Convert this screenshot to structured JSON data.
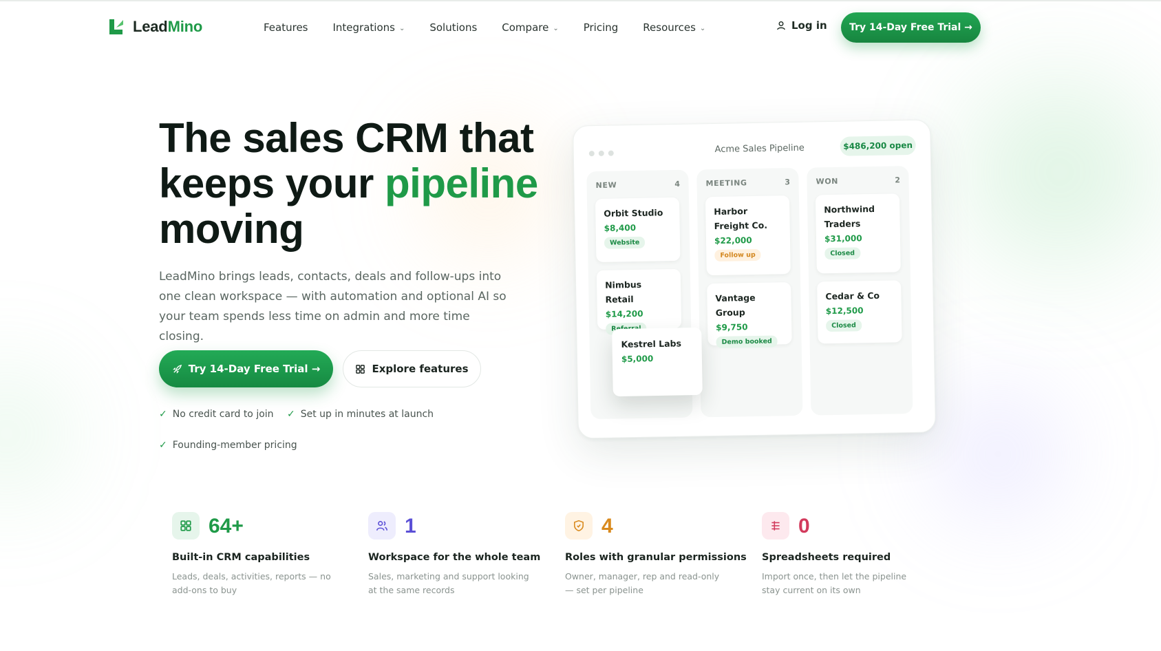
{
  "brand": {
    "name_part1": "Lead",
    "name_part2": "Mino",
    "accent": "#1f9a48"
  },
  "nav": {
    "links": [
      {
        "label": "Features",
        "dropdown": false
      },
      {
        "label": "Integrations",
        "dropdown": true
      },
      {
        "label": "Solutions",
        "dropdown": false
      },
      {
        "label": "Compare",
        "dropdown": true
      },
      {
        "label": "Pricing",
        "dropdown": false
      },
      {
        "label": "Resources",
        "dropdown": true
      }
    ],
    "login": "Log in",
    "cta": "Try 14-Day Free Trial →"
  },
  "hero": {
    "title_line1": "The sales CRM that",
    "title_line2_a": "keeps your ",
    "title_line2_b": "pipeline",
    "title_line3": "moving",
    "subtitle": "LeadMino brings leads, contacts, deals and follow-ups into one clean workspace — with automation and optional AI so your team spends less time on admin and more time closing.",
    "primary_cta": "Try 14-Day Free Trial →",
    "secondary_cta": "Explore features",
    "checks": [
      "No credit card to join",
      "Set up in minutes at launch",
      "Founding-member pricing"
    ]
  },
  "board": {
    "title": "Acme Sales Pipeline",
    "open_total": "$486,200 open",
    "columns": [
      {
        "name": "NEW",
        "count": "4",
        "cards": [
          {
            "name": "Orbit Studio",
            "amount": "$8,400",
            "tag": "Website",
            "tag_color": "green"
          },
          {
            "name": "Nimbus Retail",
            "amount": "$14,200",
            "tag": "Referral",
            "tag_color": "green"
          }
        ]
      },
      {
        "name": "MEETING",
        "count": "3",
        "cards": [
          {
            "name": "Harbor Freight Co.",
            "amount": "$22,000",
            "tag": "Follow up",
            "tag_color": "orange"
          },
          {
            "name": "Vantage Group",
            "amount": "$9,750",
            "tag": "Demo booked",
            "tag_color": "green"
          }
        ]
      },
      {
        "name": "WON",
        "count": "2",
        "cards": [
          {
            "name": "Northwind Traders",
            "amount": "$31,000",
            "tag": "Closed",
            "tag_color": "green"
          },
          {
            "name": "Cedar & Co",
            "amount": "$12,500",
            "tag": "Closed",
            "tag_color": "green"
          }
        ]
      }
    ],
    "dragging_card": {
      "name": "Kestrel Labs",
      "amount": "$5,000"
    }
  },
  "stats": [
    {
      "icon": "grid-icon",
      "value": "64+",
      "color": "#1f9a48",
      "title": "Built-in CRM capabilities",
      "desc": "Leads, deals, activities, reports — no add-ons to buy"
    },
    {
      "icon": "users-icon",
      "value": "1",
      "color": "#5b50d6",
      "title": "Workspace for the whole team",
      "desc": "Sales, marketing and support looking at the same records"
    },
    {
      "icon": "shield-icon",
      "value": "4",
      "color": "#d98a1e",
      "title": "Roles with granular permissions",
      "desc": "Owner, manager, rep and read-only — set per pipeline"
    },
    {
      "icon": "table-icon",
      "value": "0",
      "color": "#d23a5c",
      "title": "Spreadsheets required",
      "desc": "Import once, then let the pipeline stay current on its own"
    }
  ]
}
